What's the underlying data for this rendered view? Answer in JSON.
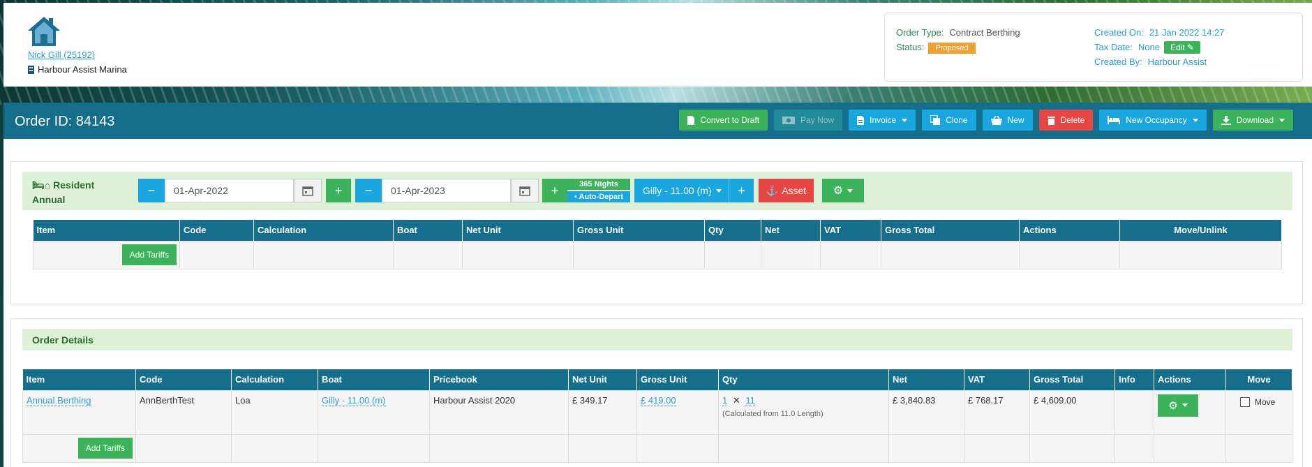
{
  "header": {
    "customer_link": "Nick Gill (25192)",
    "marina": "Harbour Assist Marina",
    "order_type_label": "Order Type:",
    "order_type_value": "Contract Berthing",
    "status_label": "Status:",
    "status_value": "Proposed",
    "created_on_label": "Created On:",
    "created_on_value": "21 Jan 2022 14:27",
    "tax_date_label": "Tax Date:",
    "tax_date_value": "None",
    "edit_label": "Edit",
    "created_by_label": "Created By:",
    "created_by_value": "Harbour Assist"
  },
  "order_bar": {
    "title": "Order ID: 84143",
    "buttons": {
      "convert": "Convert to Draft",
      "pay": "Pay Now",
      "invoice": "Invoice",
      "clone": "Clone",
      "new": "New",
      "delete": "Delete",
      "occupancy": "New Occupancy",
      "download": "Download"
    }
  },
  "resident": {
    "label_line1": "Resident",
    "label_line2": "Annual",
    "start_date": "01-Apr-2022",
    "end_date": "01-Apr-2023",
    "nights": "365 Nights",
    "auto_depart": "Auto-Depart",
    "boat": "Gilly - 11.00 (m)",
    "asset": "Asset",
    "table_headers": [
      "Item",
      "Code",
      "Calculation",
      "Boat",
      "Net Unit",
      "Gross Unit",
      "Qty",
      "Net",
      "VAT",
      "Gross Total",
      "Actions",
      "Move/Unlink"
    ],
    "add_tariffs": "Add Tariffs"
  },
  "order_details": {
    "title": "Order Details",
    "table_headers": [
      "Item",
      "Code",
      "Calculation",
      "Boat",
      "Pricebook",
      "Net Unit",
      "Gross Unit",
      "Qty",
      "Net",
      "VAT",
      "Gross Total",
      "Info",
      "Actions",
      "Move"
    ],
    "row": {
      "item": "Annual Berthing",
      "code": "AnnBerthTest",
      "calculation": "Loa",
      "boat": "Gilly - 11.00 (m)",
      "pricebook": "Harbour Assist 2020",
      "net_unit": "£ 349.17",
      "gross_unit": "£ 419.00",
      "qty_a": "1",
      "qty_x": "✕",
      "qty_b": "11",
      "qty_note": "(Calculated from 11.0 Length)",
      "net": "£ 3,840.83",
      "vat": "£ 768.17",
      "gross_total": "£ 4,609.00",
      "info": "",
      "move": "Move"
    },
    "add_tariffs": "Add Tariffs"
  },
  "colors": {
    "header_bar": "#156e8c",
    "green": "#3cb35a",
    "blue": "#1aa7e0",
    "red": "#e84545",
    "orange": "#f0a030"
  }
}
